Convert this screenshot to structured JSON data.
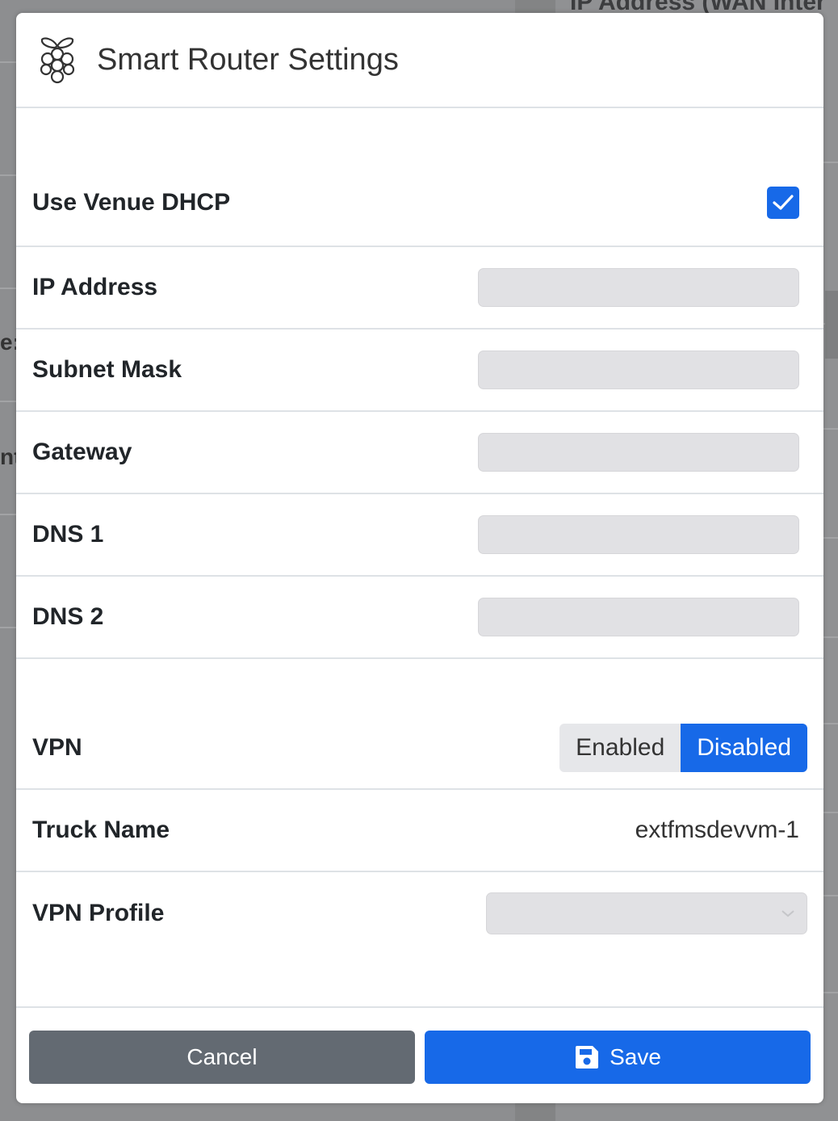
{
  "background": {
    "header_text": "IP Address (WAN Inter",
    "left_fragments": [
      "e:",
      "nt"
    ]
  },
  "modal": {
    "title": "Smart Router Settings",
    "logo_icon": "raspberry-pi-icon"
  },
  "fields": {
    "use_venue_dhcp": {
      "label": "Use Venue DHCP",
      "checked": true
    },
    "ip_address": {
      "label": "IP Address",
      "value": ""
    },
    "subnet_mask": {
      "label": "Subnet Mask",
      "value": ""
    },
    "gateway": {
      "label": "Gateway",
      "value": ""
    },
    "dns1": {
      "label": "DNS 1",
      "value": ""
    },
    "dns2": {
      "label": "DNS 2",
      "value": ""
    },
    "vpn": {
      "label": "VPN",
      "options": [
        "Enabled",
        "Disabled"
      ],
      "selected": "Disabled"
    },
    "truck_name": {
      "label": "Truck Name",
      "value": "extfmsdevvm-1"
    },
    "vpn_profile": {
      "label": "VPN Profile",
      "value": ""
    }
  },
  "footer": {
    "cancel_label": "Cancel",
    "save_label": "Save",
    "save_icon": "floppy-disk-icon"
  },
  "colors": {
    "primary": "#1769e8",
    "secondary": "#636a72",
    "input_disabled": "#e1e1e4"
  }
}
